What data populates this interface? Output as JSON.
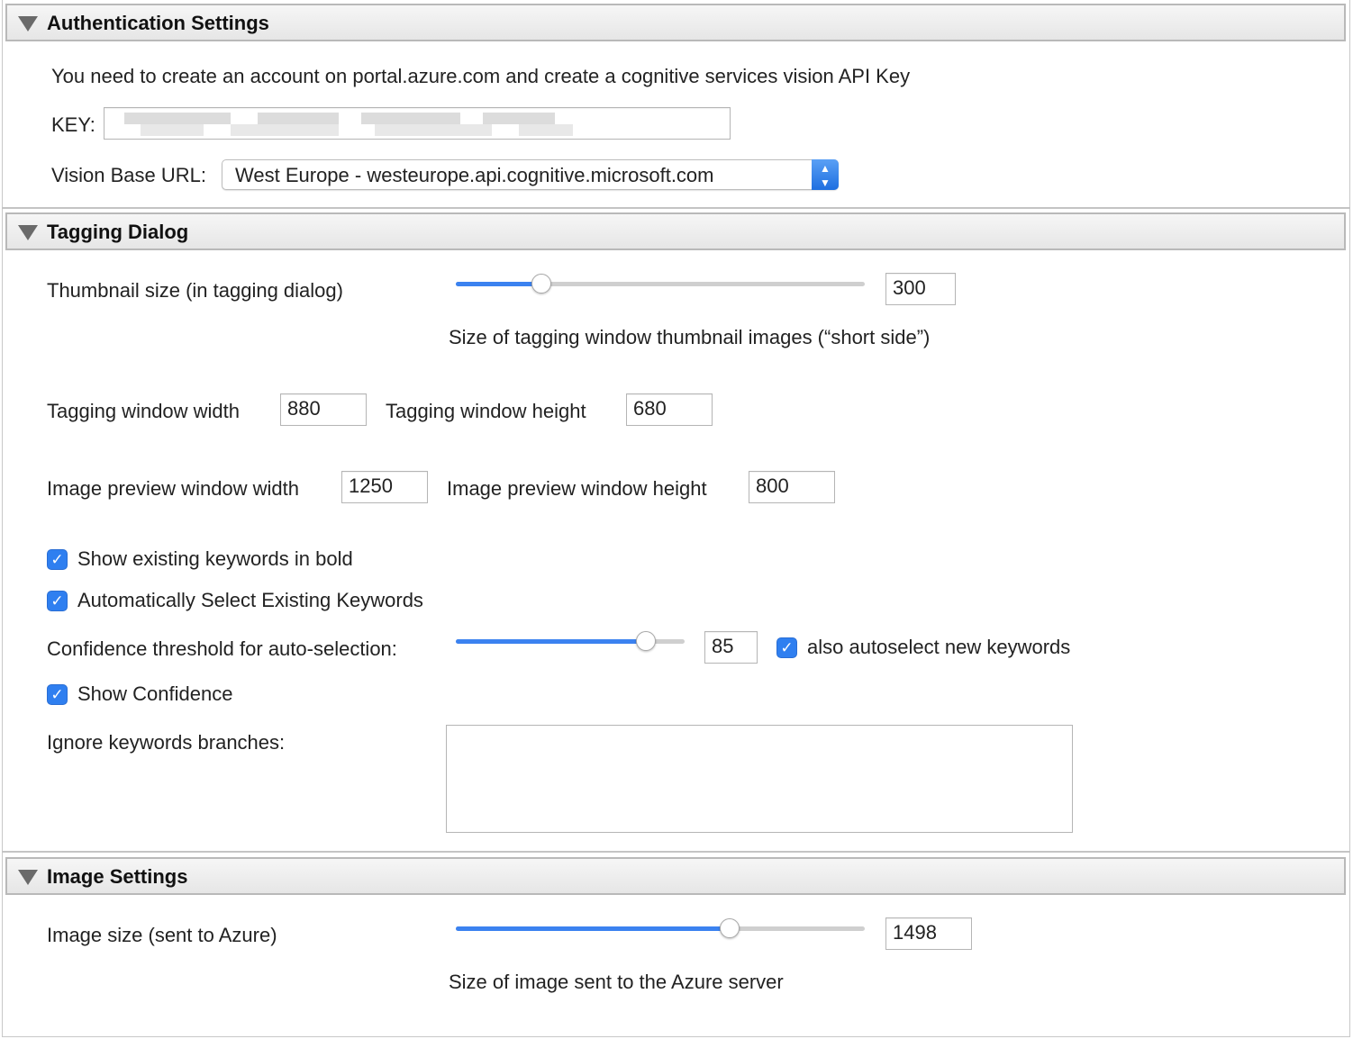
{
  "sections": {
    "auth": {
      "title": "Authentication Settings",
      "description": "You need to create an account on portal.azure.com and create a cognitive services vision API Key",
      "key_label": "KEY:",
      "vision_url_label": "Vision Base URL:",
      "vision_url_value": "West Europe - westeurope.api.cognitive.microsoft.com",
      "stepper_glyph": "⌃⌄"
    },
    "tagging": {
      "title": "Tagging Dialog",
      "thumbnail_label": "Thumbnail size (in tagging dialog)",
      "thumbnail_value": "300",
      "thumbnail_slider_fraction": 0.21,
      "thumbnail_hint": "Size of tagging window thumbnail images (“short side”)",
      "window_width_label": "Tagging window width",
      "window_width_value": "880",
      "window_height_label": "Tagging window height",
      "window_height_value": "680",
      "preview_width_label": "Image preview window width",
      "preview_width_value": "1250",
      "preview_height_label": "Image preview window height",
      "preview_height_value": "800",
      "show_bold_label": "Show existing keywords in bold",
      "show_bold_checked": true,
      "auto_select_label": "Automatically Select Existing Keywords",
      "auto_select_checked": true,
      "confidence_label": "Confidence threshold for auto-selection:",
      "confidence_value": "85",
      "confidence_slider_fraction": 0.83,
      "also_autoselect_label": "also autoselect new keywords",
      "also_autoselect_checked": true,
      "show_confidence_label": "Show Confidence",
      "show_confidence_checked": true,
      "ignore_branches_label": "Ignore keywords branches:",
      "ignore_branches_value": ""
    },
    "image": {
      "title": "Image Settings",
      "size_label": "Image size (sent to Azure)",
      "size_value": "1498",
      "size_slider_fraction": 0.67,
      "size_hint": "Size of image sent to the Azure server"
    }
  },
  "icons": {
    "disclosure": "disclosure-triangle-icon",
    "checkmark": "✓",
    "popup_stepper": "popup-stepper-icon"
  },
  "colors": {
    "accent": "#3b82f0",
    "header_bg": "#ececec",
    "border": "#b9b9b9"
  }
}
